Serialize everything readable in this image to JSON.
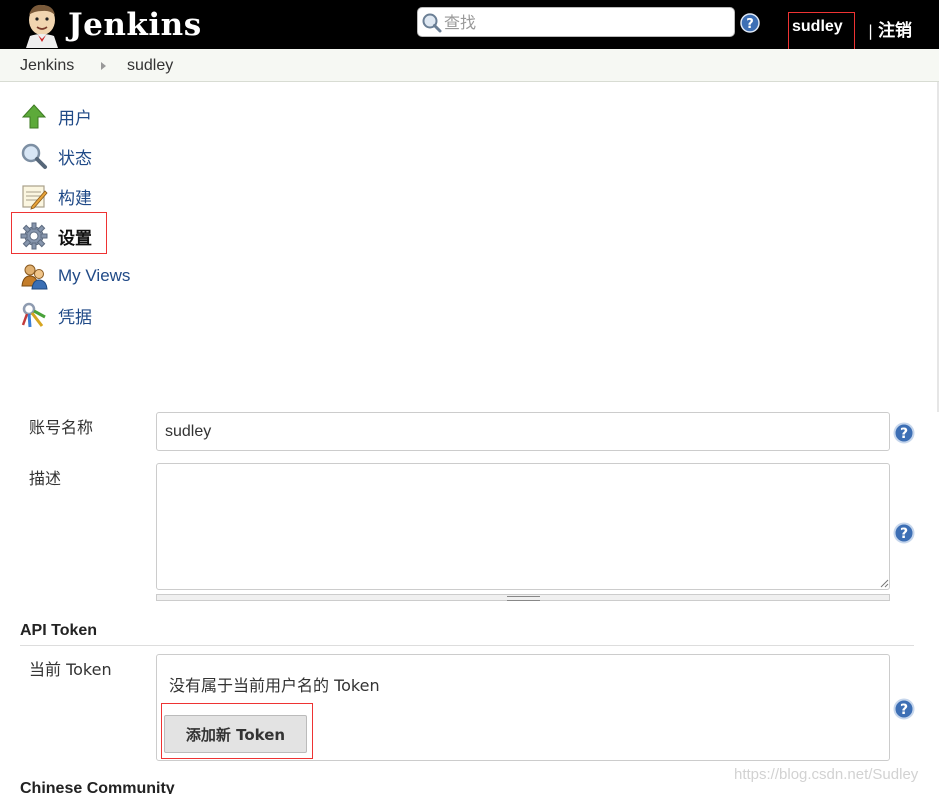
{
  "header": {
    "title": "Jenkins",
    "search_placeholder": "查找",
    "user": "sudley",
    "logout_separator": "|",
    "logout_label": "注销"
  },
  "breadcrumb": [
    "Jenkins",
    "sudley"
  ],
  "tasks": [
    {
      "label": "用户",
      "icon": "up-arrow-icon"
    },
    {
      "label": "状态",
      "icon": "magnifier-icon"
    },
    {
      "label": "构建",
      "icon": "notepad-icon"
    },
    {
      "label": "设置",
      "icon": "gear-icon"
    },
    {
      "label": "My Views",
      "icon": "user-group-icon"
    },
    {
      "label": "凭据",
      "icon": "keys-icon"
    }
  ],
  "form": {
    "fullname_label": "账号名称",
    "fullname_value": "sudley",
    "description_label": "描述",
    "description_value": ""
  },
  "api_token": {
    "section_title": "API Token",
    "current_label": "当前 Token",
    "empty_message": "没有属于当前用户名的 Token",
    "add_button": "添加新 Token"
  },
  "next_section_title": "Chinese Community",
  "watermark": "https://blog.csdn.net/Sudley",
  "colors": {
    "header_bg": "#000000",
    "link": "#204a87",
    "highlight_border": "#ee3333",
    "breadcrumb_bg": "#f6f8f3"
  }
}
